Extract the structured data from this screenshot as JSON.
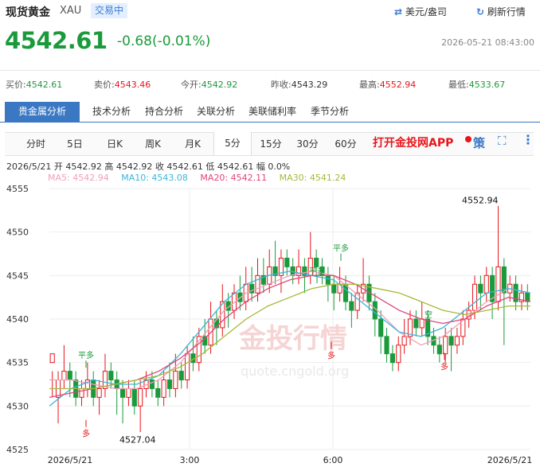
{
  "header": {
    "title": "现货黄金",
    "symbol": "XAU",
    "status": "交易中",
    "currency_toggle": "美元/盎司",
    "refresh_label": "刷新行情"
  },
  "quote": {
    "price": "4542.61",
    "change": "-0.68(-0.01%)",
    "datetime": "2026-05-21 08:43:00"
  },
  "stats": [
    {
      "label": "买价:",
      "value": "4542.61",
      "color": "#1b9a3c"
    },
    {
      "label": "卖价:",
      "value": "4543.46",
      "color": "#e8141b"
    },
    {
      "label": "今开:",
      "value": "4542.92",
      "color": "#1b9a3c"
    },
    {
      "label": "昨收:",
      "value": "4543.29",
      "color": "#333333"
    },
    {
      "label": "最高:",
      "value": "4552.94",
      "color": "#e8141b"
    },
    {
      "label": "最低:",
      "value": "4533.67",
      "color": "#1b9a3c"
    }
  ],
  "category_tabs": [
    "贵金属分析",
    "技术分析",
    "持合分析",
    "关联分析",
    "美联储利率",
    "季节分析"
  ],
  "period_tabs": [
    "分时",
    "5日",
    "日K",
    "周K",
    "月K",
    "5分",
    "15分",
    "30分",
    "60分"
  ],
  "active_period": "5分",
  "promo": "打开金投网APP",
  "strategy_label": "策",
  "candle_info": "2026/5/21  开 4542.92  高 4542.92  收 4542.61  低 4542.61  幅 0.0%",
  "ma_legend": [
    {
      "label": "MA5: 4542.94",
      "color": "#f0a0b8"
    },
    {
      "label": "MA10: 4543.08",
      "color": "#3ab6d9"
    },
    {
      "label": "MA20: 4542.11",
      "color": "#e0457a"
    },
    {
      "label": "MA30: 4541.24",
      "color": "#a8b83a"
    }
  ],
  "watermark": {
    "brand": "金投行情",
    "url": "quote.cngold.org"
  },
  "chart_data": {
    "type": "candlestick",
    "ylim": [
      4525,
      4555
    ],
    "y_ticks": [
      "4555",
      "4550",
      "4545",
      "4540",
      "4535",
      "4530",
      "4525"
    ],
    "x_labels": [
      "2026/5/21",
      "3:00",
      "6:00",
      "2026/5/21"
    ],
    "annotations": {
      "high_label": "4552.94",
      "low_label": "4527.04",
      "signals": [
        "平多",
        "多",
        "平多",
        "多",
        "平多",
        "空",
        "多"
      ]
    },
    "candles": [
      [
        4535,
        4536,
        4534,
        4531
      ],
      [
        4531,
        4533,
        4534,
        4528
      ],
      [
        4533,
        4534,
        4537,
        4532
      ],
      [
        4534,
        4533,
        4535,
        4531
      ],
      [
        4533,
        4531,
        4534,
        4530
      ],
      [
        4531,
        4532,
        4533,
        4530
      ],
      [
        4532,
        4533,
        4535,
        4531
      ],
      [
        4533,
        4531,
        4534,
        4530
      ],
      [
        4531,
        4532,
        4533,
        4529
      ],
      [
        4532,
        4534,
        4536,
        4531
      ],
      [
        4534,
        4533,
        4535,
        4532
      ],
      [
        4533,
        4532,
        4534,
        4529
      ],
      [
        4532,
        4531,
        4533,
        4528
      ],
      [
        4531,
        4532,
        4533,
        4530
      ],
      [
        4532,
        4530,
        4533,
        4529
      ],
      [
        4530,
        4532,
        4533,
        4527
      ],
      [
        4532,
        4533,
        4534,
        4531
      ],
      [
        4533,
        4532,
        4534,
        4531
      ],
      [
        4532,
        4531,
        4533,
        4530
      ],
      [
        4531,
        4533,
        4534,
        4530
      ],
      [
        4533,
        4532,
        4535,
        4531
      ],
      [
        4532,
        4534,
        4536,
        4531
      ],
      [
        4534,
        4533,
        4535,
        4532
      ],
      [
        4533,
        4536,
        4537,
        4532
      ],
      [
        4536,
        4535,
        4538,
        4534
      ],
      [
        4535,
        4538,
        4539,
        4534
      ],
      [
        4538,
        4537,
        4540,
        4536
      ],
      [
        4537,
        4540,
        4542,
        4536
      ],
      [
        4540,
        4539,
        4541,
        4537
      ],
      [
        4539,
        4542,
        4544,
        4538
      ],
      [
        4542,
        4541,
        4543,
        4539
      ],
      [
        4541,
        4543,
        4544,
        4540
      ],
      [
        4543,
        4542,
        4545,
        4541
      ],
      [
        4542,
        4544,
        4546,
        4541
      ],
      [
        4544,
        4543,
        4546,
        4542
      ],
      [
        4543,
        4545,
        4547,
        4542
      ],
      [
        4545,
        4544,
        4547,
        4543
      ],
      [
        4544,
        4546,
        4548,
        4543
      ],
      [
        4546,
        4545,
        4549,
        4544
      ],
      [
        4545,
        4547,
        4548,
        4543
      ],
      [
        4547,
        4546,
        4548,
        4545
      ],
      [
        4546,
        4545,
        4547,
        4544
      ],
      [
        4545,
        4546,
        4548,
        4544
      ],
      [
        4546,
        4545,
        4547,
        4543
      ],
      [
        4545,
        4547,
        4550,
        4544
      ],
      [
        4547,
        4546,
        4548,
        4545
      ],
      [
        4546,
        4545,
        4547,
        4544
      ],
      [
        4545,
        4544,
        4546,
        4542
      ],
      [
        4544,
        4543,
        4545,
        4541
      ],
      [
        4543,
        4544,
        4546,
        4542
      ],
      [
        4544,
        4542,
        4545,
        4541
      ],
      [
        4542,
        4541,
        4543,
        4539
      ],
      [
        4541,
        4543,
        4544,
        4540
      ],
      [
        4543,
        4544,
        4547,
        4542
      ],
      [
        4544,
        4542,
        4545,
        4541
      ],
      [
        4542,
        4540,
        4543,
        4538
      ],
      [
        4540,
        4538,
        4541,
        4536
      ],
      [
        4538,
        4536,
        4539,
        4535
      ],
      [
        4536,
        4535,
        4537,
        4534
      ],
      [
        4535,
        4537,
        4538,
        4534
      ],
      [
        4537,
        4538,
        4540,
        4536
      ],
      [
        4538,
        4540,
        4541,
        4537
      ],
      [
        4540,
        4539,
        4541,
        4538
      ],
      [
        4539,
        4540,
        4542,
        4538
      ],
      [
        4540,
        4538,
        4541,
        4537
      ],
      [
        4538,
        4537,
        4539,
        4536
      ],
      [
        4537,
        4536,
        4538,
        4535
      ],
      [
        4536,
        4538,
        4539,
        4535
      ],
      [
        4538,
        4537,
        4539,
        4534
      ],
      [
        4537,
        4538,
        4539,
        4536
      ],
      [
        4538,
        4540,
        4541,
        4537
      ],
      [
        4540,
        4541,
        4542,
        4539
      ],
      [
        4541,
        4544,
        4545,
        4540
      ],
      [
        4544,
        4543,
        4545,
        4541
      ],
      [
        4543,
        4545,
        4546,
        4542
      ],
      [
        4545,
        4542,
        4546,
        4540
      ],
      [
        4542,
        4546,
        4553,
        4541
      ],
      [
        4546,
        4543,
        4547,
        4537
      ],
      [
        4543,
        4544,
        4545,
        4542
      ],
      [
        4544,
        4542,
        4545,
        4541
      ],
      [
        4542,
        4543,
        4544,
        4541
      ],
      [
        4543,
        4542,
        4544,
        4541
      ]
    ],
    "ma": {
      "MA5": {
        "start": 4533.0,
        "points": [
          4533,
          4533,
          4532.5,
          4532,
          4532,
          4533,
          4535,
          4538,
          4541,
          4543,
          4544,
          4545,
          4545.5,
          4545,
          4543,
          4541,
          4538.5,
          4537,
          4538,
          4540,
          4542,
          4543.5,
          4543
        ]
      },
      "MA10": {
        "start": 4530.0,
        "points": [
          4530,
          4532,
          4533,
          4532.5,
          4532.5,
          4533.5,
          4536,
          4539,
          4542,
          4544,
          4545,
          4545.5,
          4545,
          4544.5,
          4542.5,
          4540.5,
          4538.5,
          4538,
          4539,
          4541,
          4543,
          4543.5,
          4543
        ]
      },
      "MA20": {
        "start": 4531.0,
        "points": [
          4531,
          4531.5,
          4532,
          4532.5,
          4533,
          4534,
          4535.5,
          4537.5,
          4540,
          4542,
          4543.5,
          4544.5,
          4545,
          4545,
          4544,
          4542.5,
          4541,
          4540,
          4539.5,
          4540,
          4541.5,
          4542.5,
          4542
        ]
      },
      "MA30": {
        "start": 4531.0,
        "points": [
          4532,
          4532,
          4532,
          4532.5,
          4533,
          4533.5,
          4534.5,
          4536,
          4538,
          4540,
          4541.5,
          4542.5,
          4543.5,
          4544,
          4544,
          4543.5,
          4543,
          4542,
          4541,
          4540.5,
          4541,
          4541.5,
          4541.5
        ]
      }
    }
  }
}
